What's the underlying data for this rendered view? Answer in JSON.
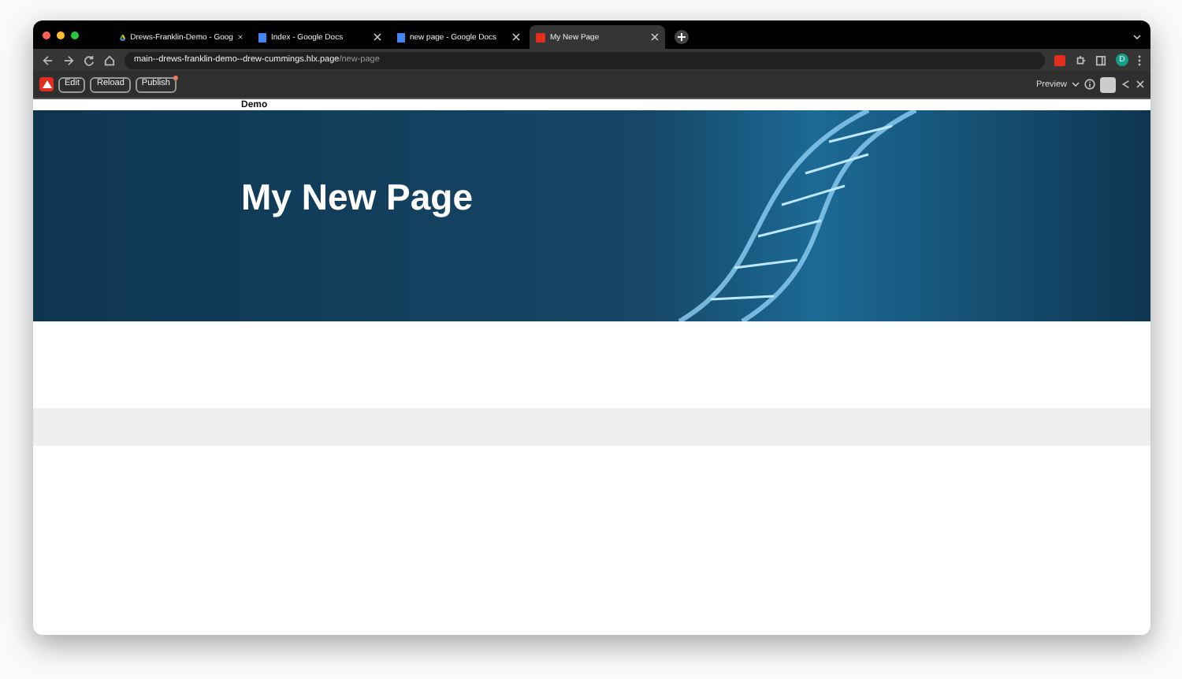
{
  "browser": {
    "tabs": [
      {
        "title": "Drews-Franklin-Demo - Goog",
        "kind": "drive",
        "selected": false
      },
      {
        "title": "Index - Google Docs",
        "kind": "docs",
        "selected": false
      },
      {
        "title": "new page - Google Docs",
        "kind": "docs",
        "selected": false
      },
      {
        "title": "My New Page",
        "kind": "app",
        "selected": true
      }
    ],
    "address": {
      "host": "main--drews-franklin-demo--drew-cummings.hlx.page",
      "path": "/new-page"
    },
    "profile_initial": "D"
  },
  "sidekick": {
    "buttons": [
      {
        "label": "Edit",
        "badge": false
      },
      {
        "label": "Reload",
        "badge": false
      },
      {
        "label": "Publish",
        "badge": true
      }
    ],
    "preview_label": "Preview"
  },
  "page": {
    "header_text": "Demo",
    "hero_title": "My New Page"
  }
}
